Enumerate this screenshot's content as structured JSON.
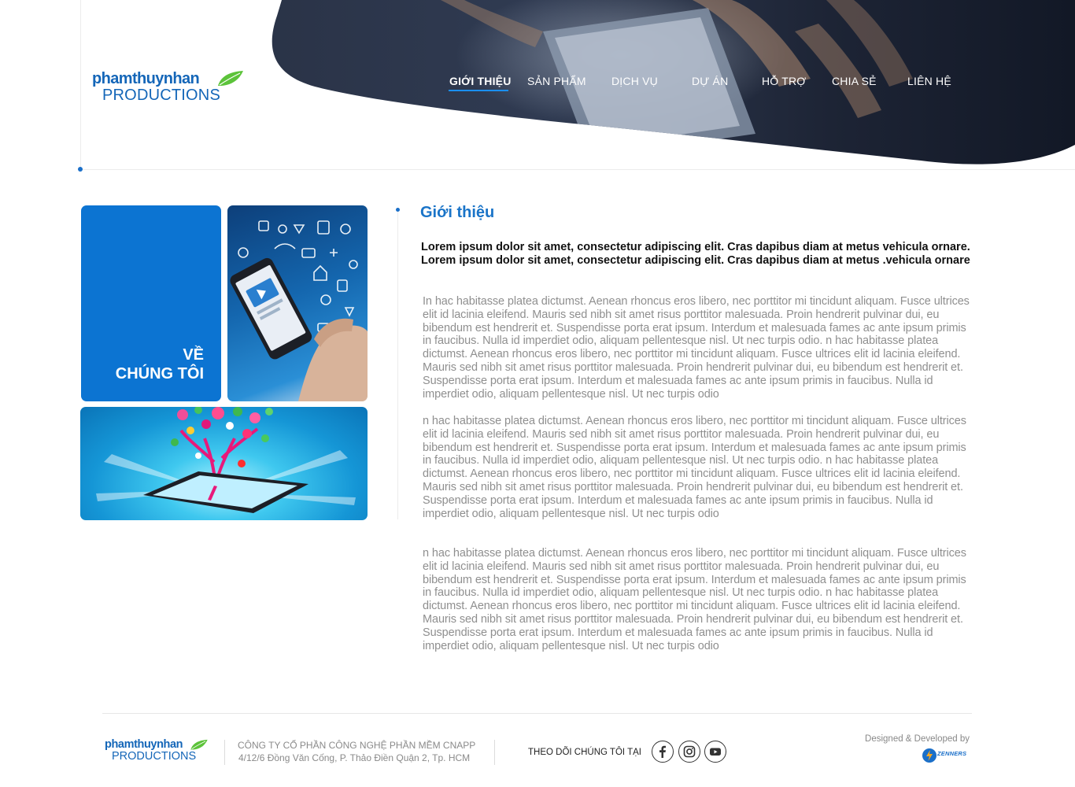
{
  "brand": {
    "line1": "phamthuynhan",
    "line2": "PRODUCTIONS",
    "color": "#1466b8",
    "leaf_color": "#5cc33a"
  },
  "nav": {
    "items": [
      {
        "label": "GIỚI THIỆU",
        "active": true
      },
      {
        "label": "SẢN PHẨM",
        "active": false
      },
      {
        "label": "DỊCH VỤ",
        "active": false
      },
      {
        "label": "DỰ ÁN",
        "active": false
      },
      {
        "label": "HỖ TRỢ",
        "active": false
      },
      {
        "label": "CHIA SẺ",
        "active": false
      },
      {
        "label": "LIÊN HỆ",
        "active": false
      }
    ],
    "active_underline_color": "#1a8ff0"
  },
  "tiles": {
    "about_line1": "VỀ",
    "about_line2": "CHÚNG TÔI",
    "about_bg": "#0c74d2"
  },
  "content": {
    "title": "Giới thiệu",
    "lead": "Lorem ipsum dolor sit amet, consectetur adipiscing elit. Cras dapibus diam at metus vehicula ornare. Lorem ipsum dolor sit amet, consectetur adipiscing elit. Cras dapibus diam at metus .vehicula ornare",
    "paragraphs": [
      "In hac habitasse platea dictumst. Aenean rhoncus eros libero, nec porttitor mi tincidunt aliquam. Fusce ultrices elit id lacinia eleifend. Mauris sed nibh sit amet risus porttitor malesuada. Proin hendrerit pulvinar dui, eu bibendum est hendrerit et. Suspendisse porta erat ipsum. Interdum et malesuada fames ac ante ipsum primis in faucibus. Nulla id imperdiet odio, aliquam pellentesque nisl. Ut nec turpis odio. n hac habitasse platea dictumst. Aenean rhoncus eros libero, nec porttitor mi tincidunt aliquam. Fusce ultrices elit id lacinia eleifend. Mauris sed nibh sit amet risus porttitor malesuada. Proin hendrerit pulvinar dui, eu bibendum est hendrerit et. Suspendisse porta erat ipsum. Interdum et malesuada fames ac ante ipsum primis in faucibus. Nulla id imperdiet odio, aliquam pellentesque nisl. Ut nec turpis odio",
      "n hac habitasse platea dictumst. Aenean rhoncus eros libero, nec porttitor mi tincidunt aliquam. Fusce ultrices elit id lacinia eleifend. Mauris sed nibh sit amet risus porttitor malesuada. Proin hendrerit pulvinar dui, eu bibendum est hendrerit et. Suspendisse porta erat ipsum. Interdum et malesuada fames ac ante ipsum primis in faucibus. Nulla id imperdiet odio, aliquam pellentesque nisl. Ut nec turpis odio. n hac habitasse platea dictumst. Aenean rhoncus eros libero, nec porttitor mi tincidunt aliquam. Fusce ultrices elit id lacinia eleifend. Mauris sed nibh sit amet risus porttitor malesuada. Proin hendrerit pulvinar dui, eu bibendum est hendrerit et. Suspendisse porta erat ipsum. Interdum et malesuada fames ac ante ipsum primis in faucibus. Nulla id imperdiet odio, aliquam pellentesque nisl. Ut nec turpis odio",
      "n hac habitasse platea dictumst. Aenean rhoncus eros libero, nec porttitor mi tincidunt aliquam. Fusce ultrices elit id lacinia eleifend. Mauris sed nibh sit amet risus porttitor malesuada. Proin hendrerit pulvinar dui, eu bibendum est hendrerit et. Suspendisse porta erat ipsum. Interdum et malesuada fames ac ante ipsum primis in faucibus. Nulla id imperdiet odio, aliquam pellentesque nisl. Ut nec turpis odio. n hac habitasse platea dictumst. Aenean rhoncus eros libero, nec porttitor mi tincidunt aliquam. Fusce ultrices elit id lacinia eleifend. Mauris sed nibh sit amet risus porttitor malesuada. Proin hendrerit pulvinar dui, eu bibendum est hendrerit et. Suspendisse porta erat ipsum. Interdum et malesuada fames ac ante ipsum primis in faucibus. Nulla id imperdiet odio, aliquam pellentesque nisl. Ut nec turpis odio"
    ],
    "title_color": "#1a74c8"
  },
  "footer": {
    "company": "CÔNG TY CỔ PHẦN CÔNG NGHỆ PHẦN MỀM CNAPP",
    "address": "4/12/6 Đồng Văn Cống, P. Thảo Điền Quận 2, Tp. HCM",
    "follow_label": "THEO DÕI CHÚNG TÔI TẠI",
    "social": [
      "facebook-icon",
      "instagram-icon",
      "youtube-icon"
    ],
    "designed_by": "Designed & Developed by",
    "developer": "ZENNERS"
  }
}
